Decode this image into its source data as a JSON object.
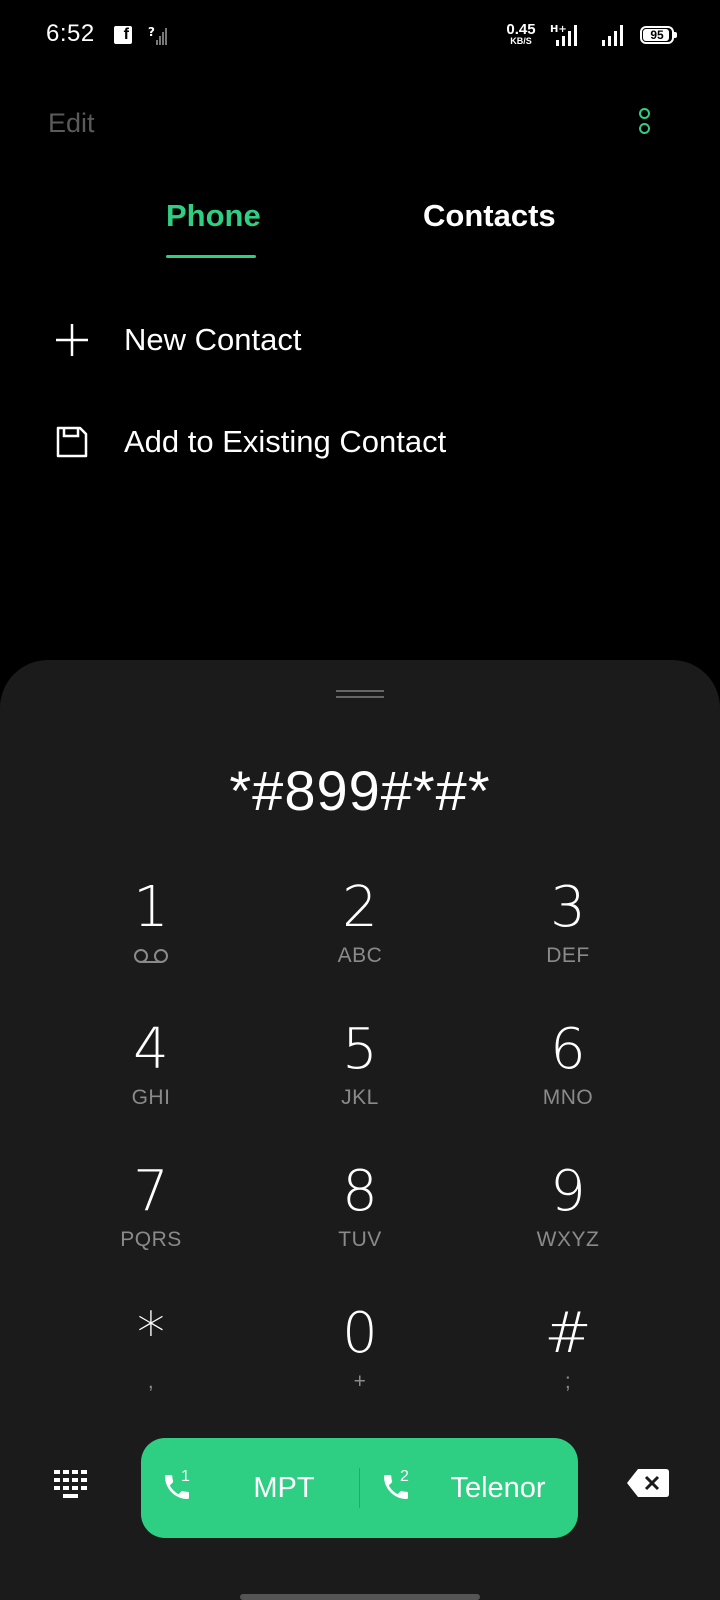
{
  "status_bar": {
    "time": "6:52",
    "fb_letter": "f",
    "net_speed_value": "0.45",
    "net_speed_unit": "KB/S",
    "battery": "95"
  },
  "header": {
    "edit_label": "Edit",
    "accent_color": "#2ecf83"
  },
  "tabs": [
    {
      "label": "Phone",
      "active": true
    },
    {
      "label": "Contacts",
      "active": false
    }
  ],
  "actions": [
    {
      "label": "New Contact",
      "icon": "plus-icon"
    },
    {
      "label": "Add to Existing Contact",
      "icon": "save-icon"
    }
  ],
  "dialer": {
    "number": "*#899#*#*",
    "keys": [
      {
        "digit": "1",
        "letters": ""
      },
      {
        "digit": "2",
        "letters": "ABC"
      },
      {
        "digit": "3",
        "letters": "DEF"
      },
      {
        "digit": "4",
        "letters": "GHI"
      },
      {
        "digit": "5",
        "letters": "JKL"
      },
      {
        "digit": "6",
        "letters": "MNO"
      },
      {
        "digit": "7",
        "letters": "PQRS"
      },
      {
        "digit": "8",
        "letters": "TUV"
      },
      {
        "digit": "9",
        "letters": "WXYZ"
      },
      {
        "digit": "*",
        "letters": ","
      },
      {
        "digit": "0",
        "letters": "+"
      },
      {
        "digit": "#",
        "letters": ";"
      }
    ]
  },
  "call_bar": {
    "sim1_number": "1",
    "sim1_name": "MPT",
    "sim2_number": "2",
    "sim2_name": "Telenor"
  }
}
